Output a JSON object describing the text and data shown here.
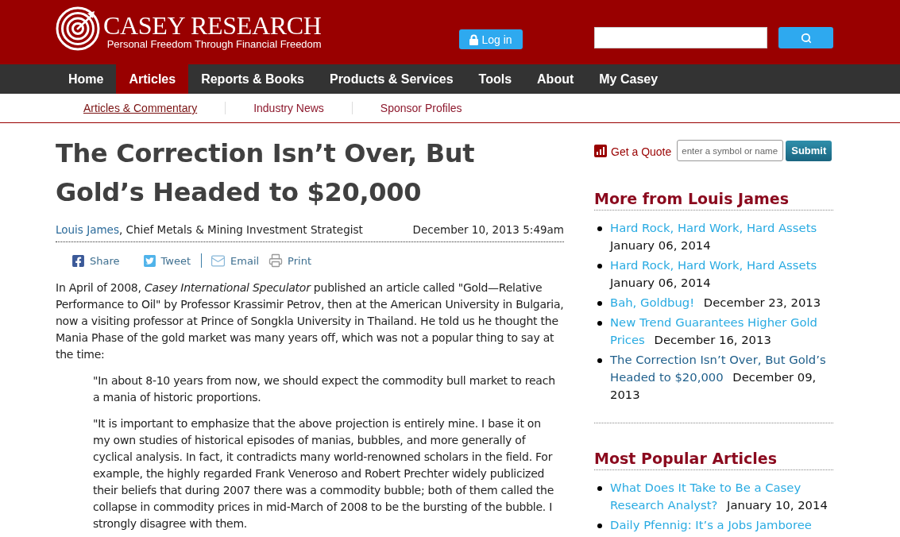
{
  "header": {
    "logo": {
      "name": "CASEY RESEARCH",
      "tagline": "Personal Freedom Through Financial Freedom"
    },
    "login_button": "Log in"
  },
  "nav": [
    {
      "label": "Home",
      "selected": false
    },
    {
      "label": "Articles",
      "selected": true
    },
    {
      "label": "Reports & Books",
      "selected": false
    },
    {
      "label": "Products & Services",
      "selected": false
    },
    {
      "label": "Tools",
      "selected": false
    },
    {
      "label": "About",
      "selected": false
    },
    {
      "label": "My Casey",
      "selected": false
    }
  ],
  "subnav": [
    {
      "label": "Articles & Commentary",
      "selected": true
    },
    {
      "label": "Industry News",
      "selected": false
    },
    {
      "label": "Sponsor Profiles",
      "selected": false
    }
  ],
  "article": {
    "title": "The Correction Isn’t Over, But Gold’s Headed to $20,000",
    "author": "Louis James",
    "author_role": ", Chief Metals & Mining Investment Strategist",
    "date": "December 10, 2013 5:49am",
    "share": {
      "social": [
        {
          "kind": "facebook",
          "label": "Share"
        },
        {
          "kind": "twitter",
          "label": "Tweet"
        }
      ],
      "tools": [
        {
          "kind": "email",
          "label": "Email"
        },
        {
          "kind": "print",
          "label": "Print"
        }
      ]
    },
    "paragraphs": [
      {
        "kind": "body",
        "text": "In April of 2008, *Casey International Speculator* published an article called \"Gold—Relative Performance to Oil\" by Professor Krassimir Petrov, then at the American University in Bulgaria, now a visiting professor at Prince of Songkla University in Thailand. He told us he thought the Mania Phase of the gold market was many years off, which was not a popular thing to say at the time:"
      },
      {
        "kind": "quote",
        "text": "\"In about 8-10 years from now, we should expect the commodity bull market to reach a mania of historic proportions."
      },
      {
        "kind": "quote",
        "text": "\"It is important to emphasize that the above projection is entirely mine. I base it on my own studies of historical episodes of manias, bubbles, and more generally of cyclical analysis. In fact, it contradicts many world-renowned scholars in the field. For example, the highly regarded Frank Veneroso and Robert Prechter widely publicized their beliefs that during 2007 there was a commodity bubble; both of them called the collapse in commodity prices in mid-March of 2008 to be the bursting of the bubble. I strongly disagree with them."
      }
    ]
  },
  "sidebar": {
    "quote": {
      "label": "Get a Quote",
      "placeholder": "enter a symbol or name",
      "button": "Submit"
    },
    "more_from": {
      "heading": "More from Louis James",
      "items": [
        {
          "title": "Hard Rock, Hard Work, Hard Assets",
          "date": "January 06, 2014",
          "current": false
        },
        {
          "title": "Hard Rock, Hard Work, Hard Assets",
          "date": "January 06, 2014",
          "current": false
        },
        {
          "title": "Bah, Goldbug!",
          "date": "December 23, 2013",
          "current": false
        },
        {
          "title": "New Trend Guarantees Higher Gold Prices",
          "date": "December 16, 2013",
          "current": false
        },
        {
          "title": "The Correction Isn’t Over, But Gold’s Headed to $20,000",
          "date": "December 09, 2013",
          "current": true
        }
      ]
    },
    "popular": {
      "heading": "Most Popular Articles",
      "items": [
        {
          "title": "What Does It Take to Be a Casey Research Analyst?",
          "date": "January 10, 2014",
          "current": false
        },
        {
          "title": "Daily Pfennig: It’s a Jobs Jamboree",
          "current": false
        }
      ]
    }
  }
}
